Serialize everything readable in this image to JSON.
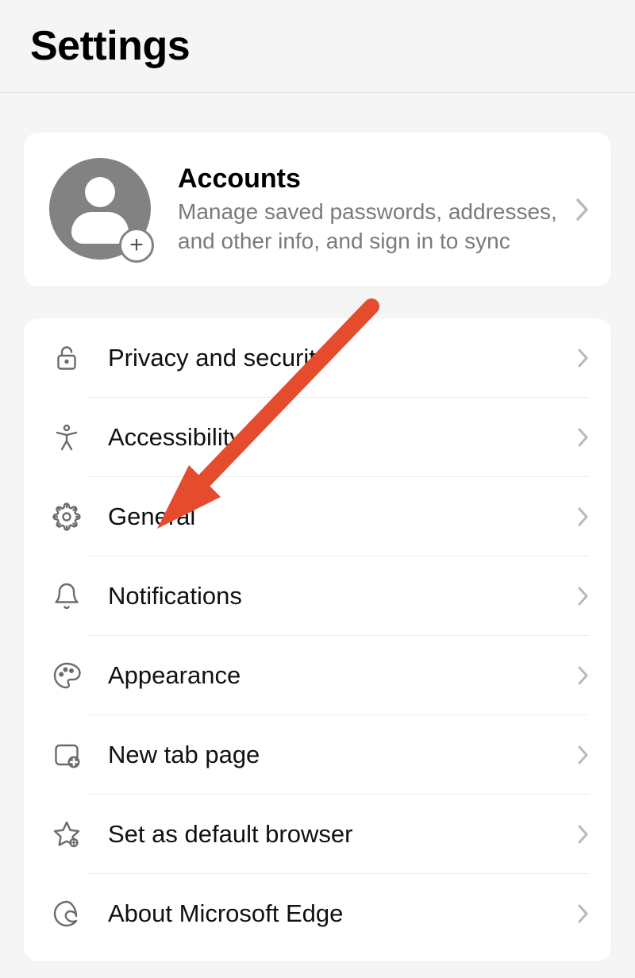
{
  "header": {
    "title": "Settings"
  },
  "accounts": {
    "title": "Accounts",
    "description": "Manage saved passwords, addresses, and other info, and sign in to sync"
  },
  "items": [
    {
      "id": "privacy",
      "label": "Privacy and security",
      "icon": "lock-icon"
    },
    {
      "id": "accessibility",
      "label": "Accessibility",
      "icon": "accessibility-icon"
    },
    {
      "id": "general",
      "label": "General",
      "icon": "gear-icon"
    },
    {
      "id": "notifications",
      "label": "Notifications",
      "icon": "bell-icon"
    },
    {
      "id": "appearance",
      "label": "Appearance",
      "icon": "palette-icon"
    },
    {
      "id": "newtab",
      "label": "New tab page",
      "icon": "new-tab-icon"
    },
    {
      "id": "default",
      "label": "Set as default browser",
      "icon": "star-gear-icon"
    },
    {
      "id": "about",
      "label": "About Microsoft Edge",
      "icon": "edge-icon"
    }
  ],
  "annotation": {
    "arrow_color": "#e54c2e",
    "target_item": "general"
  }
}
